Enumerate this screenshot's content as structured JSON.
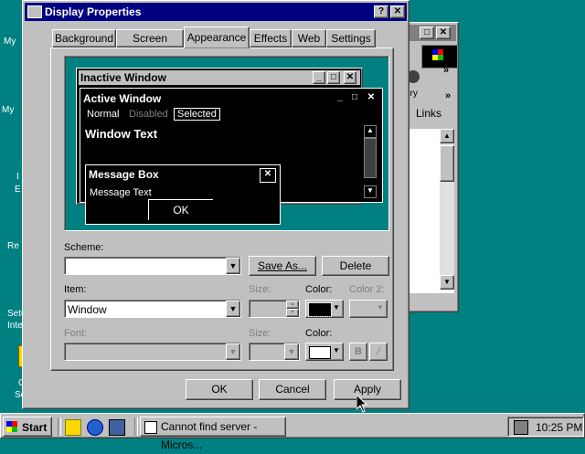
{
  "desktop": {
    "labels": [
      "My",
      "My",
      "I",
      "E",
      "Re",
      "Setup",
      "Interne",
      "Onli",
      "Servi"
    ]
  },
  "background_window": {
    "links_label": "Links",
    "ribbon_label": "ory"
  },
  "dialog": {
    "title": "Display Properties",
    "tabs": [
      "Background",
      "Screen Saver",
      "Appearance",
      "Effects",
      "Web",
      "Settings"
    ],
    "active_tab": "Appearance",
    "preview": {
      "inactive_title": "Inactive Window",
      "active_title": "Active Window",
      "menu_normal": "Normal",
      "menu_disabled": "Disabled",
      "menu_selected": "Selected",
      "window_text": "Window Text",
      "msgbox_title": "Message Box",
      "msgbox_text": "Message Text",
      "msgbox_ok": "OK"
    },
    "scheme_label": "Scheme:",
    "scheme_value": "",
    "save_as_label": "Save As...",
    "delete_label": "Delete",
    "item_label": "Item:",
    "item_value": "Window",
    "size_label": "Size:",
    "color_label": "Color:",
    "color2_label": "Color 2:",
    "font_label": "Font:",
    "font_size_label": "Size:",
    "font_color_label": "Color:",
    "bold_label": "B",
    "italic_label": "/",
    "ok_label": "OK",
    "cancel_label": "Cancel",
    "apply_label": "Apply"
  },
  "taskbar": {
    "start_label": "Start",
    "task_label": "Cannot find server - Micros...",
    "clock": "10:25 PM"
  },
  "colors": {
    "desktop": "#008080",
    "titlebar": "#000080",
    "face": "#c0c0c0"
  }
}
